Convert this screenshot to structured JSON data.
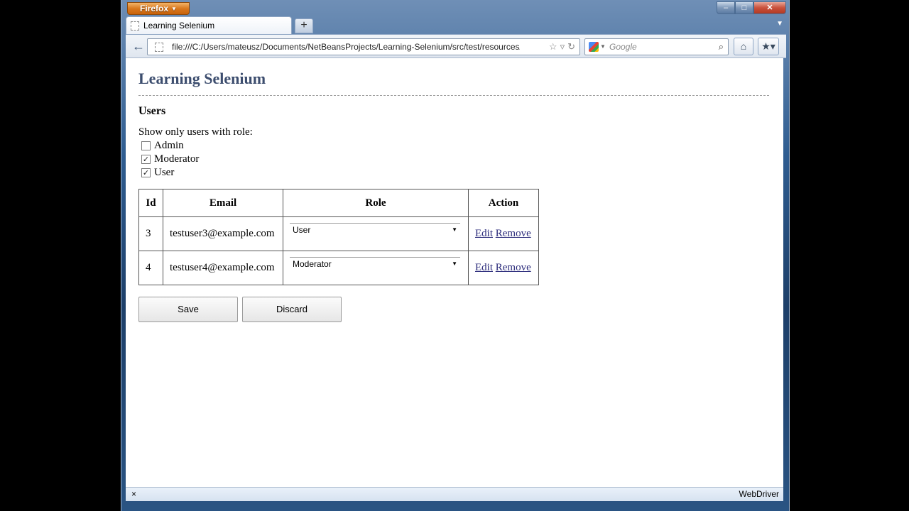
{
  "browser": {
    "app_button": "Firefox",
    "window_controls": {
      "minimize": "‒",
      "maximize": "□",
      "close": "✕"
    },
    "tab": {
      "title": "Learning Selenium"
    },
    "new_tab": "+",
    "url": "file:///C:/Users/mateusz/Documents/NetBeansProjects/Learning-Selenium/src/test/resources/selenium",
    "search_placeholder": "Google",
    "status_close": "×",
    "status_text": "WebDriver"
  },
  "page": {
    "title": "Learning Selenium",
    "section_title": "Users",
    "filter_label": "Show only users with role:",
    "filters": [
      {
        "label": "Admin",
        "checked": false
      },
      {
        "label": "Moderator",
        "checked": true
      },
      {
        "label": "User",
        "checked": true
      }
    ],
    "table": {
      "headers": [
        "Id",
        "Email",
        "Role",
        "Action"
      ],
      "rows": [
        {
          "id": "3",
          "email": "testuser3@example.com",
          "role": "User",
          "edit": "Edit",
          "remove": "Remove"
        },
        {
          "id": "4",
          "email": "testuser4@example.com",
          "role": "Moderator",
          "edit": "Edit",
          "remove": "Remove"
        }
      ]
    },
    "buttons": {
      "save": "Save",
      "discard": "Discard"
    }
  },
  "icons": [
    "back-arrow-icon",
    "star-bookmark-icon",
    "reload-icon",
    "search-magnifier-icon",
    "home-icon",
    "bookmarks-icon"
  ],
  "colors": {
    "title": "#3c4d6e",
    "firefox_orange": "#d9781e",
    "link": "#2a2a7a"
  }
}
